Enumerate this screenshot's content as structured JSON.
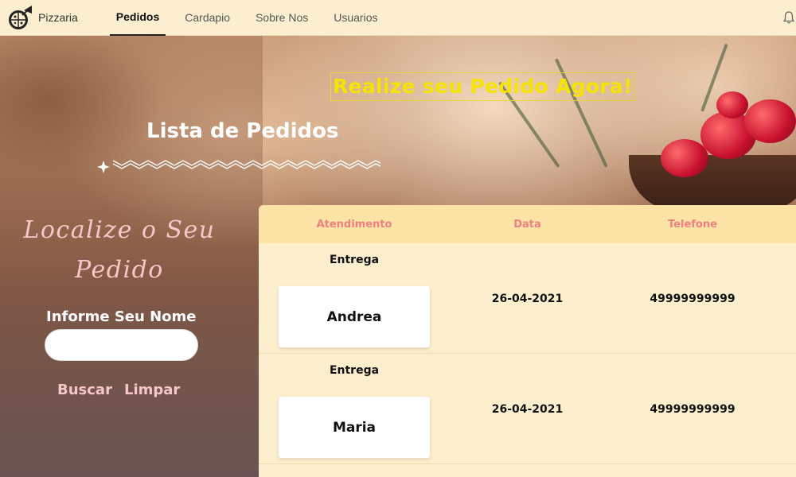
{
  "nav": {
    "brand": "Pizzaria",
    "items": [
      {
        "label": "Pedidos",
        "active": true
      },
      {
        "label": "Cardapio",
        "active": false
      },
      {
        "label": "Sobre Nos",
        "active": false
      },
      {
        "label": "Usuarios",
        "active": false
      }
    ]
  },
  "hero": {
    "promo": "Realize seu Pedido Agora!",
    "list_title": "Lista de Pedidos"
  },
  "search": {
    "title_line1": "Localize o Seu",
    "title_line2": "Pedido",
    "name_label": "Informe Seu Nome",
    "name_value": "",
    "search_button": "Buscar",
    "clear_button": "Limpar"
  },
  "table": {
    "headers": [
      "Atendimento",
      "Data",
      "Telefone"
    ],
    "rows": [
      {
        "type": "Entrega",
        "name": "Andrea",
        "date": "26-04-2021",
        "phone": "49999999999"
      },
      {
        "type": "Entrega",
        "name": "Maria",
        "date": "26-04-2021",
        "phone": "49999999999"
      }
    ]
  },
  "colors": {
    "nav_bg": "#fcefd0",
    "table_header_bg": "#fde3a5",
    "table_header_text": "#f08080",
    "promo_text": "#f4e400",
    "pink_text": "#f7c6c6"
  },
  "icons": [
    "pizza-logo-icon",
    "bell-icon",
    "divider-ornament"
  ]
}
